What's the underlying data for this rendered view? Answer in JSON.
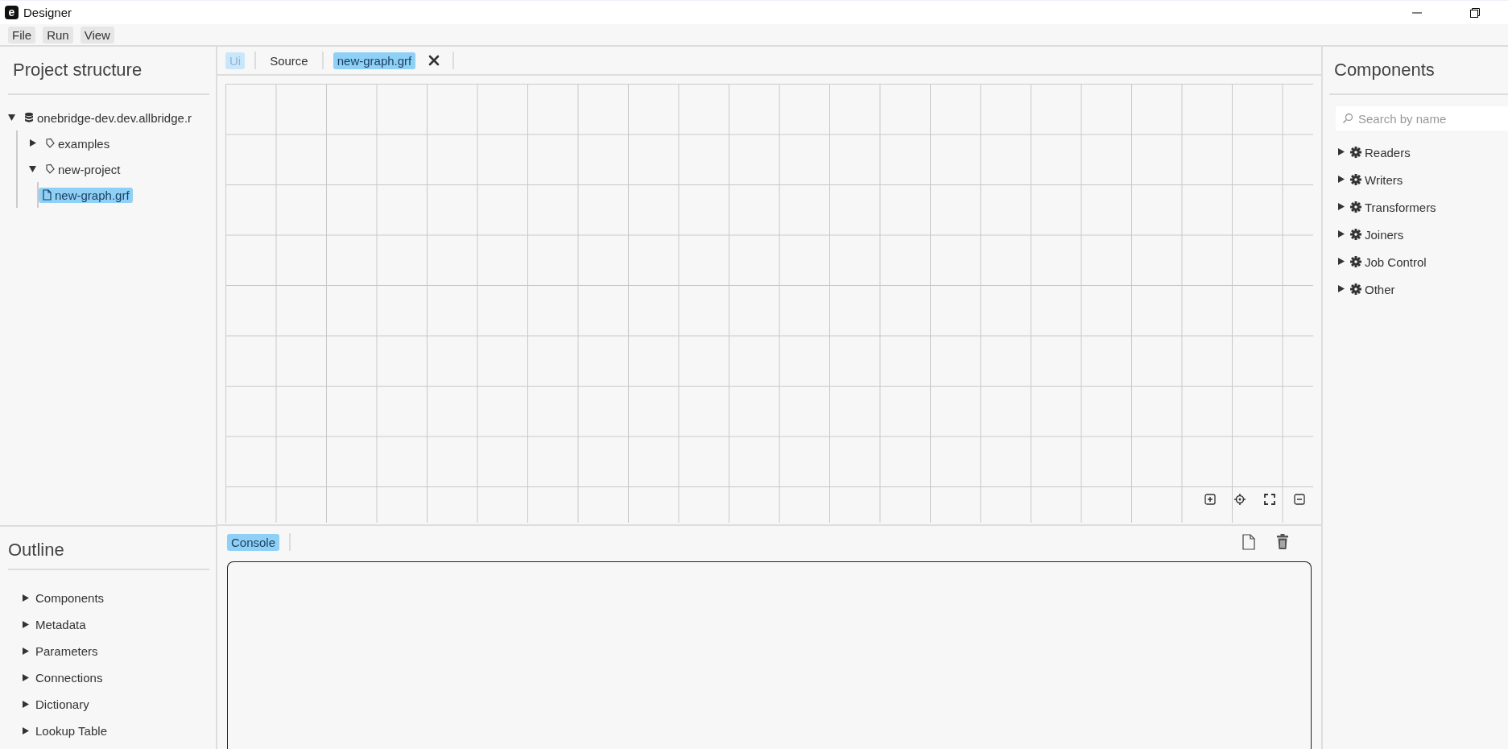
{
  "window": {
    "logo": "e",
    "title": "Designer"
  },
  "menu": [
    "File",
    "Run",
    "View"
  ],
  "project_structure": {
    "title": "Project structure",
    "tree": [
      {
        "label": "onebridge-dev.dev.allbridge.r",
        "kind": "database",
        "expanded": true,
        "selected": false,
        "children": [
          {
            "label": "examples",
            "kind": "project",
            "expanded": false,
            "selected": false
          },
          {
            "label": "new-project",
            "kind": "project",
            "expanded": true,
            "selected": false,
            "children": [
              {
                "label": "new-graph.grf",
                "kind": "file",
                "selected": true
              }
            ]
          }
        ]
      }
    ]
  },
  "outline": {
    "title": "Outline",
    "items": [
      {
        "label": "Components",
        "expanded": false
      },
      {
        "label": "Metadata",
        "expanded": false
      },
      {
        "label": "Parameters",
        "expanded": false
      },
      {
        "label": "Connections",
        "expanded": false
      },
      {
        "label": "Dictionary",
        "expanded": false
      },
      {
        "label": "Lookup Table",
        "expanded": false
      }
    ]
  },
  "editor": {
    "view_tabs": [
      {
        "label": "Ui",
        "selected": true
      },
      {
        "label": "Source",
        "selected": false
      }
    ],
    "file_tabs": [
      {
        "label": "new-graph.grf",
        "selected": true
      }
    ]
  },
  "console": {
    "tabs": [
      {
        "label": "Console",
        "selected": true
      }
    ]
  },
  "components": {
    "title": "Components",
    "search": {
      "placeholder": "Search by name"
    },
    "categories": [
      {
        "label": "Readers",
        "expanded": false
      },
      {
        "label": "Writers",
        "expanded": false
      },
      {
        "label": "Transformers",
        "expanded": false
      },
      {
        "label": "Joiners",
        "expanded": false
      },
      {
        "label": "Job Control",
        "expanded": false
      },
      {
        "label": "Other",
        "expanded": false
      }
    ]
  }
}
